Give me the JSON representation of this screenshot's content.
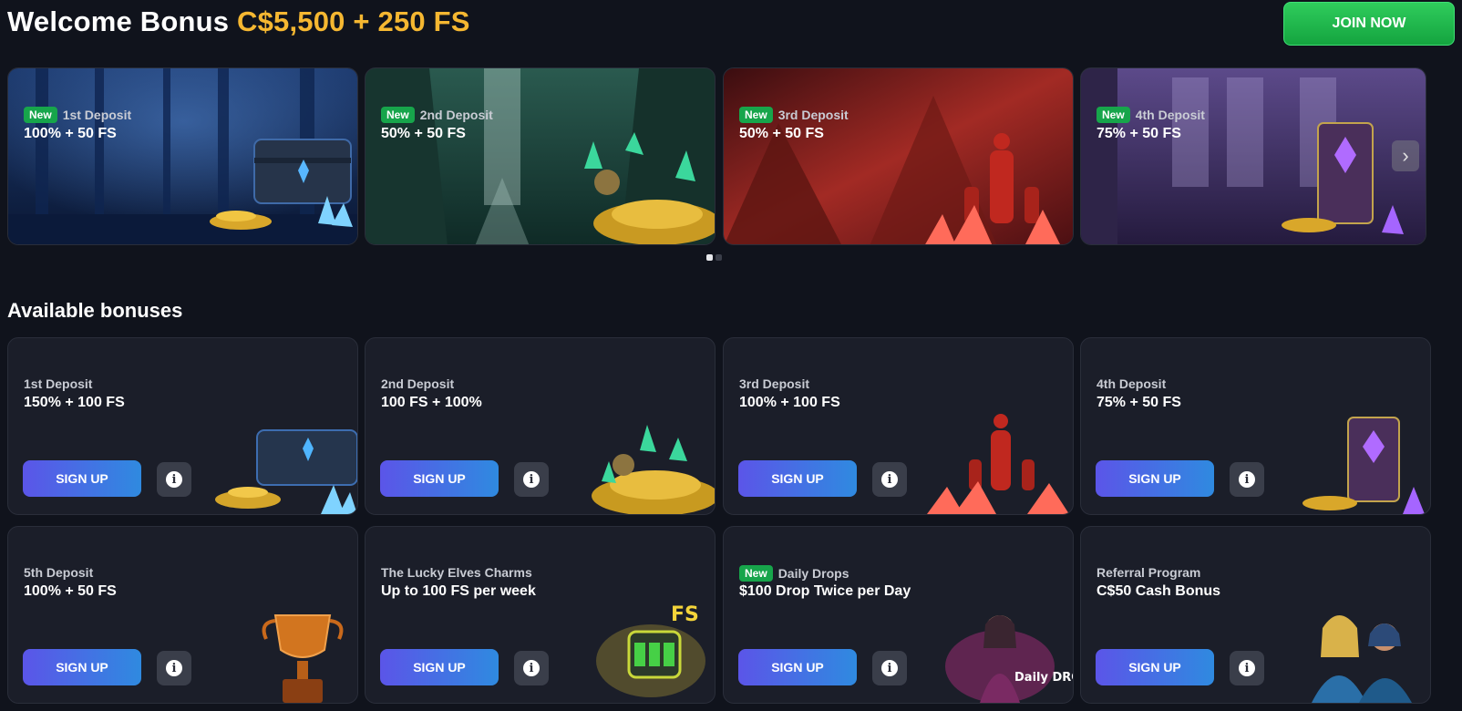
{
  "header": {
    "title_text": "Welcome Bonus ",
    "title_highlight": "C$5,500 + 250 FS",
    "join_label": "JOIN NOW"
  },
  "badge_new": "New",
  "carousel": {
    "slides": [
      {
        "subtitle": "1st Deposit",
        "offer": "100% + 50 FS",
        "is_new": true,
        "theme": "blue-chest"
      },
      {
        "subtitle": "2nd Deposit",
        "offer": "50% + 50 FS",
        "is_new": true,
        "theme": "green-treasure"
      },
      {
        "subtitle": "3rd Deposit",
        "offer": "50% + 50 FS",
        "is_new": true,
        "theme": "red-statue"
      },
      {
        "subtitle": "4th Deposit",
        "offer": "75% + 50 FS",
        "is_new": true,
        "theme": "purple-throne"
      }
    ],
    "next_icon": "chevron-right-icon",
    "pages": 2,
    "active_page": 1
  },
  "section_title": "Available bonuses",
  "bonuses": [
    {
      "subtitle": "1st Deposit",
      "offer": "150% + 100 FS",
      "is_new": false,
      "cta": "SIGN UP",
      "art": "chest"
    },
    {
      "subtitle": "2nd Deposit",
      "offer": "100 FS + 100%",
      "is_new": false,
      "cta": "SIGN UP",
      "art": "gold"
    },
    {
      "subtitle": "3rd Deposit",
      "offer": "100% + 100 FS",
      "is_new": false,
      "cta": "SIGN UP",
      "art": "statue"
    },
    {
      "subtitle": "4th Deposit",
      "offer": "75% + 50 FS",
      "is_new": false,
      "cta": "SIGN UP",
      "art": "throne"
    },
    {
      "subtitle": "5th Deposit",
      "offer": "100% + 50 FS",
      "is_new": false,
      "cta": "SIGN UP",
      "art": "trophy"
    },
    {
      "subtitle": "The Lucky Elves Charms",
      "offer": "Up to 100 FS per week",
      "is_new": false,
      "cta": "SIGN UP",
      "art": "slot"
    },
    {
      "subtitle": "Daily Drops",
      "offer": "$100 Drop Twice per Day",
      "is_new": true,
      "cta": "SIGN UP",
      "art": "drops"
    },
    {
      "subtitle": "Referral Program",
      "offer": "C$50 Cash Bonus",
      "is_new": false,
      "cta": "SIGN UP",
      "art": "elves"
    }
  ],
  "art_text": {
    "drops": "Daily DROPS",
    "slot": "FS"
  },
  "info_icon": "info-icon",
  "colors": {
    "background": "#10131c",
    "card": "#1b1e29",
    "highlight": "#f5b731",
    "join_green": "#1fb44d",
    "new_badge": "#17a54b",
    "signup_start": "#5b55e8",
    "signup_end": "#2f8ae0"
  }
}
